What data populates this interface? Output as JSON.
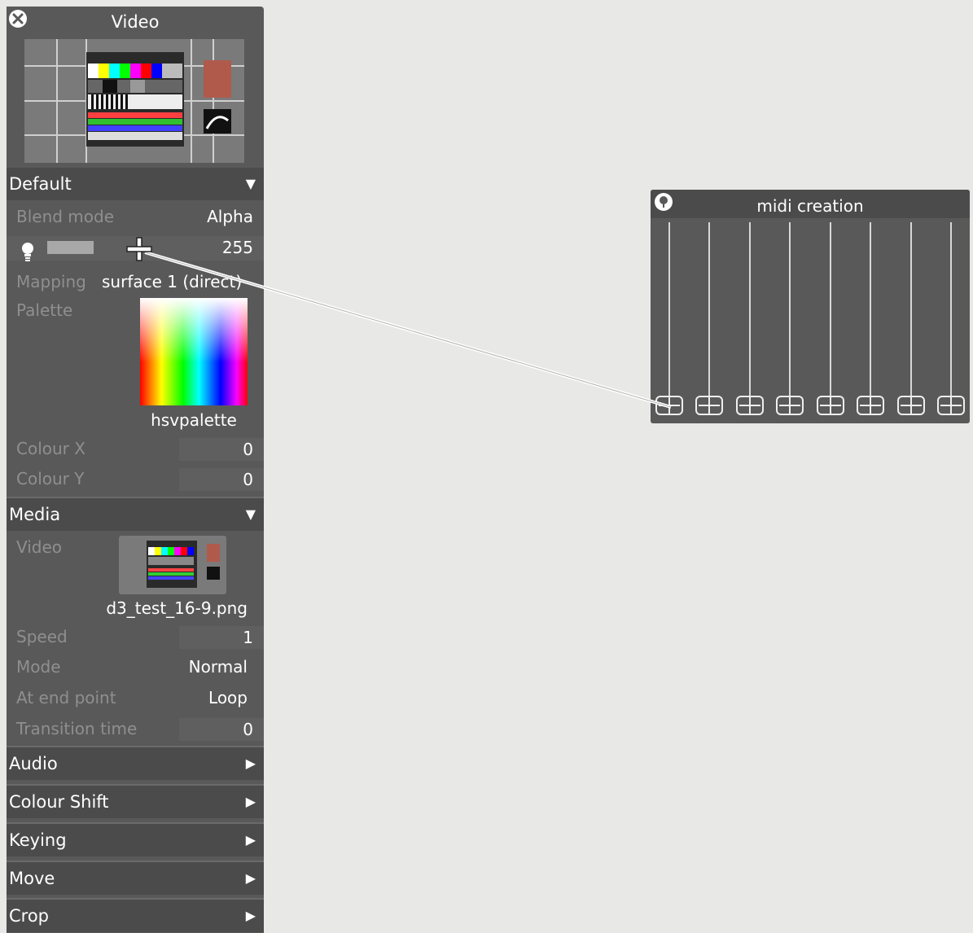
{
  "panel": {
    "title": "Video",
    "close_icon": "close-icon",
    "sections": {
      "default": {
        "label": "Default",
        "blend_label": "Blend mode",
        "blend_value": "Alpha",
        "brightness_value": "255",
        "mapping_label": "Mapping",
        "mapping_value": "surface 1 (direct)",
        "palette_label": "Palette",
        "palette_name": "hsvpalette",
        "colour_x_label": "Colour X",
        "colour_x_value": "0",
        "colour_y_label": "Colour Y",
        "colour_y_value": "0"
      },
      "media": {
        "label": "Media",
        "video_label": "Video",
        "video_file": "d3_test_16-9.png",
        "speed_label": "Speed",
        "speed_value": "1",
        "mode_label": "Mode",
        "mode_value": "Normal",
        "end_label": "At end point",
        "end_value": "Loop",
        "transition_label": "Transition time",
        "transition_value": "0"
      },
      "collapsed": [
        "Audio",
        "Colour Shift",
        "Keying",
        "Move",
        "Crop"
      ]
    }
  },
  "midi": {
    "title": "midi creation",
    "pin_icon": "pin-icon",
    "fader_count": 8
  },
  "colors": {
    "panel_bg": "#595959",
    "header_bg": "#4b4b4b",
    "canvas_bg": "#e8e8e6"
  }
}
